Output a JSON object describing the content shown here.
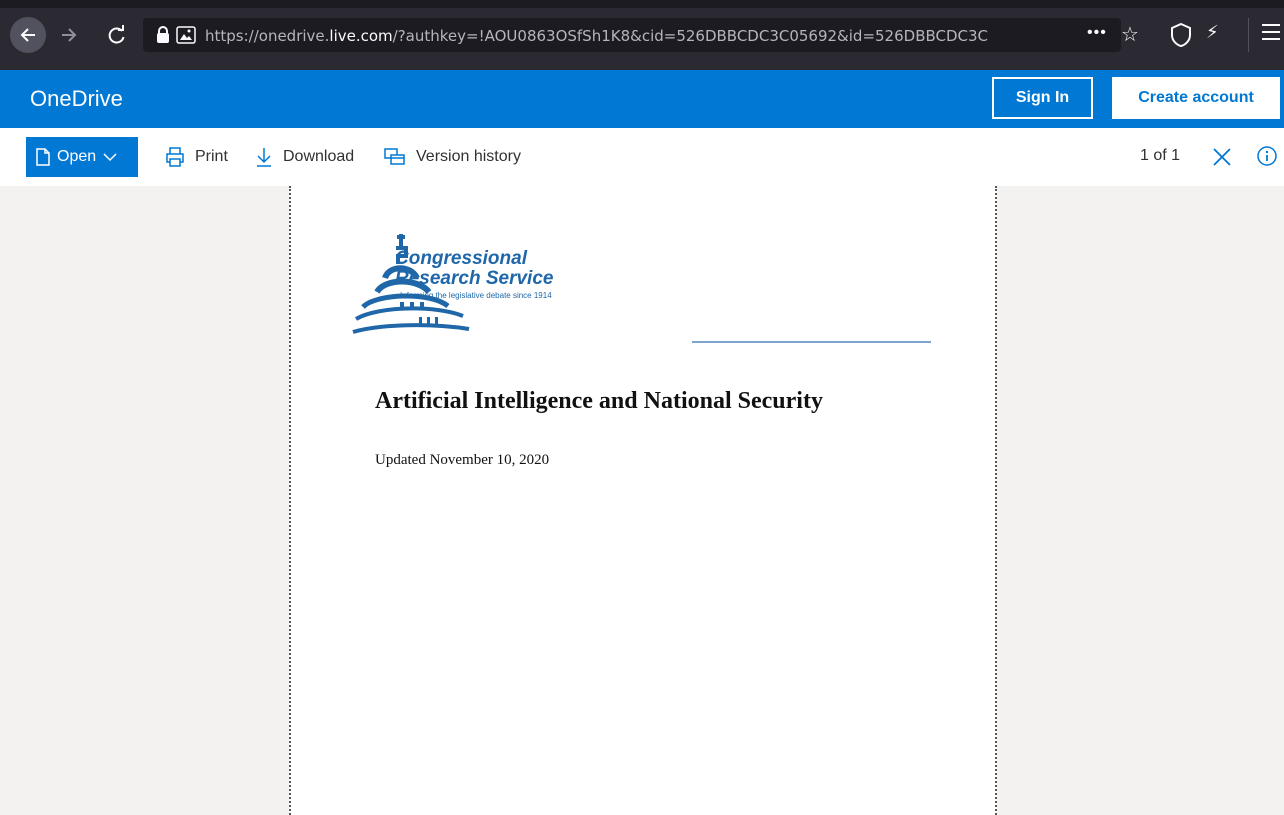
{
  "browser": {
    "url_prefix": "https://onedrive.",
    "url_domain": "live.com",
    "url_rest": "/?authkey=!AOU0863OSfSh1K8&cid=526DBBCDC3C05692&id=526DBBCDC3C",
    "icons": [
      "back-arrow-icon",
      "forward-arrow-icon",
      "reload-icon",
      "lock-icon",
      "page-image-icon",
      "more-icon",
      "bookmark-star-icon",
      "shield-icon",
      "extension-wand-icon",
      "hamburger-menu-icon"
    ]
  },
  "header": {
    "brand": "OneDrive",
    "sign_in": "Sign In",
    "create_account": "Create account",
    "brand_color": "#0078d4"
  },
  "toolbar": {
    "open_label": "Open",
    "print_label": "Print",
    "download_label": "Download",
    "version_history_label": "Version history",
    "page_count": "1 of 1"
  },
  "document": {
    "org_line1": "Congressional",
    "org_line2": "Research Service",
    "tagline": "Informing the legislative debate since 1914",
    "title": "Artificial Intelligence and National Security",
    "date": "Updated November 10, 2020",
    "logo_color": "#1f67a8"
  }
}
